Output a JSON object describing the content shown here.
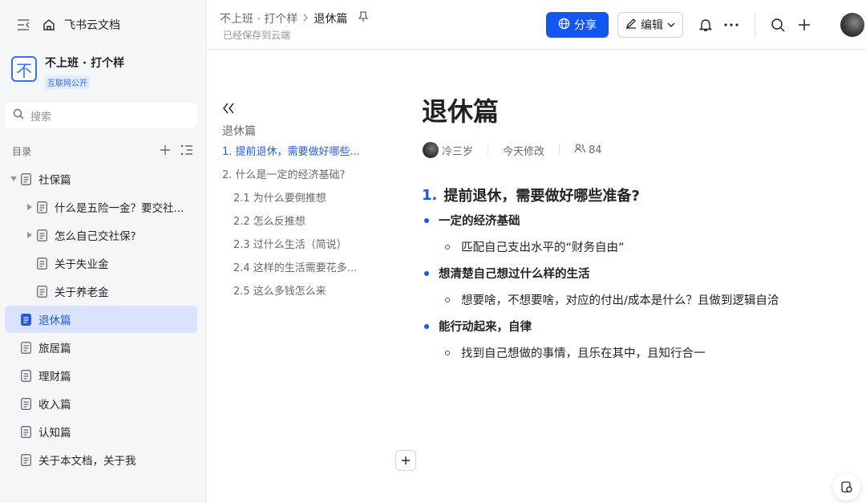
{
  "app": {
    "brand": "飞书云文档"
  },
  "space": {
    "logo_char": "不",
    "name": "不上班 · 打个样",
    "badge": "互联网公开"
  },
  "search": {
    "placeholder": "搜索"
  },
  "toc": {
    "heading": "目录"
  },
  "tree": [
    {
      "label": "社保篇",
      "indent": 0,
      "caret": "down",
      "active": false
    },
    {
      "label": "什么是五险一金？要交社...",
      "indent": 1,
      "caret": "right",
      "active": false
    },
    {
      "label": "怎么自己交社保?",
      "indent": 1,
      "caret": "right",
      "active": false
    },
    {
      "label": "关于失业金",
      "indent": 1,
      "caret": "none",
      "active": false
    },
    {
      "label": "关于养老金",
      "indent": 1,
      "caret": "none",
      "active": false
    },
    {
      "label": "退休篇",
      "indent": 0,
      "caret": "none",
      "active": true
    },
    {
      "label": "旅居篇",
      "indent": 0,
      "caret": "none",
      "active": false
    },
    {
      "label": "理财篇",
      "indent": 0,
      "caret": "none",
      "active": false
    },
    {
      "label": "收入篇",
      "indent": 0,
      "caret": "none",
      "active": false
    },
    {
      "label": "认知篇",
      "indent": 0,
      "caret": "none",
      "active": false
    },
    {
      "label": "关于本文档，关于我",
      "indent": 0,
      "caret": "none",
      "active": false
    }
  ],
  "header": {
    "breadcrumb": [
      "不上班 · 打个样",
      "退休篇"
    ],
    "saved": "已经保存到云端",
    "share": "分享",
    "edit": "编辑"
  },
  "outline": {
    "title": "退休篇",
    "items": [
      {
        "label": "1. 提前退休，需要做好哪些...",
        "sub": false,
        "active": true
      },
      {
        "label": "2. 什么是一定的经济基础?",
        "sub": false,
        "active": false
      },
      {
        "label": "2.1 为什么要倒推想",
        "sub": true,
        "active": false
      },
      {
        "label": "2.2 怎么反推想",
        "sub": true,
        "active": false
      },
      {
        "label": "2.3 过什么生活（简说）",
        "sub": true,
        "active": false
      },
      {
        "label": "2.4 这样的生活需要花多...",
        "sub": true,
        "active": false
      },
      {
        "label": "2.5 这么多钱怎么来",
        "sub": true,
        "active": false
      }
    ]
  },
  "doc": {
    "title": "退休篇",
    "author": "冷三岁",
    "modified": "今天修改",
    "viewers": "84",
    "heading_num": "1.",
    "heading": "提前退休，需要做好哪些准备?",
    "bullets": [
      {
        "level": 1,
        "text": "一定的经济基础"
      },
      {
        "level": 2,
        "text": "匹配自己支出水平的“财务自由”"
      },
      {
        "level": 1,
        "text": "想清楚自己想过什么样的生活"
      },
      {
        "level": 2,
        "text": "想要啥，不想要啥，对应的付出/成本是什么？且做到逻辑自洽"
      },
      {
        "level": 1,
        "text": "能行动起来，自律"
      },
      {
        "level": 2,
        "text": "找到自己想做的事情，且乐在其中，且知行合一"
      }
    ]
  },
  "colors": {
    "accent": "#1456f0",
    "active_bg": "#d9e3fb",
    "sidebar_bg": "#f5f6f7"
  },
  "icons": [
    "collapse-sidebar-icon",
    "home-icon",
    "search-icon",
    "plus-icon",
    "list-icon",
    "caret-icon",
    "doc-icon",
    "pin-icon",
    "globe-icon",
    "pen-icon",
    "chevron-down-icon",
    "bell-icon",
    "more-icon",
    "double-chevron-left-icon",
    "users-icon",
    "help-icon"
  ]
}
